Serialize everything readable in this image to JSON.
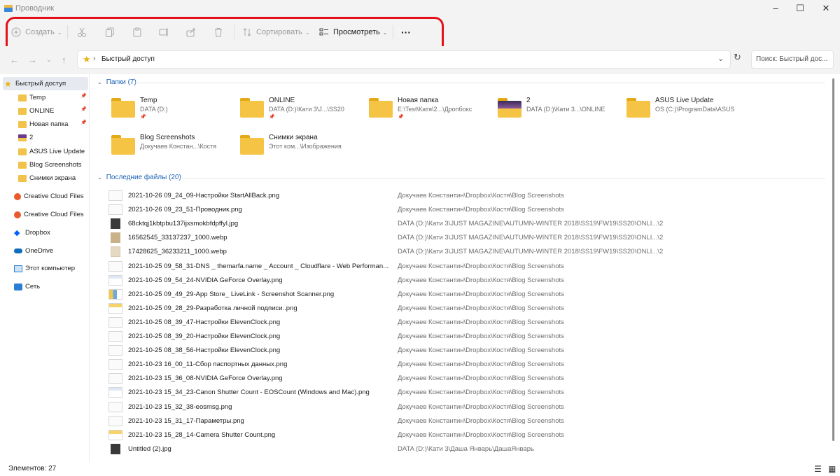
{
  "window": {
    "title": "Проводник"
  },
  "toolbar": {
    "create_label": "Создать",
    "sort_label": "Сортировать",
    "view_label": "Просмотреть",
    "more_label": "···"
  },
  "address": {
    "path": "Быстрый доступ",
    "search_placeholder": "Поиск: Быстрый дос..."
  },
  "sidebar": {
    "items": [
      {
        "label": "Быстрый доступ",
        "icon": "star-icon",
        "pinned": false,
        "selected": true
      },
      {
        "label": "Temp",
        "icon": "folder-icon",
        "pinned": true
      },
      {
        "label": "ONLINE",
        "icon": "folder-icon",
        "pinned": true
      },
      {
        "label": "Новая папка",
        "icon": "folder-icon",
        "pinned": true
      },
      {
        "label": "2",
        "icon": "folder-image-icon",
        "pinned": false
      },
      {
        "label": "ASUS Live Update",
        "icon": "folder-icon",
        "pinned": false
      },
      {
        "label": "Blog Screenshots",
        "icon": "folder-icon",
        "pinned": false
      },
      {
        "label": "Снимки экрана",
        "icon": "folder-icon",
        "pinned": false
      },
      {
        "label": "Creative Cloud Files",
        "icon": "creative-cloud-icon",
        "pinned": false
      },
      {
        "label": "Creative Cloud Files",
        "icon": "creative-cloud-icon",
        "pinned": false
      },
      {
        "label": "Dropbox",
        "icon": "dropbox-icon",
        "pinned": false
      },
      {
        "label": "OneDrive",
        "icon": "onedrive-icon",
        "pinned": false
      },
      {
        "label": "Этот компьютер",
        "icon": "computer-icon",
        "pinned": false
      },
      {
        "label": "Сеть",
        "icon": "network-icon",
        "pinned": false
      }
    ]
  },
  "folders_section": {
    "header": "Папки (7)",
    "items": [
      {
        "name": "Temp",
        "path": "DATA (D:)",
        "pinned": true
      },
      {
        "name": "ONLINE",
        "path": "DATA (D:)\\Кати 3\\J...\\SS20",
        "pinned": true
      },
      {
        "name": "Новая папка",
        "path": "E:\\Test\\Катя\\2...\\Дропбокс",
        "pinned": true
      },
      {
        "name": "2",
        "path": "DATA (D:)\\Кати 3...\\ONLINE",
        "pinned": false
      },
      {
        "name": "ASUS Live Update",
        "path": "OS (C:)\\ProgramData\\ASUS",
        "pinned": false
      },
      {
        "name": "Blog Screenshots",
        "path": "Докучаев Констан...\\Костя",
        "pinned": false
      },
      {
        "name": "Снимки экрана",
        "path": "Этот ком...\\Изображения",
        "pinned": false
      }
    ]
  },
  "recent_section": {
    "header": "Последние файлы (20)",
    "files": [
      {
        "name": "2021-10-26 09_24_09-Настройки StartAllBack.png",
        "location": "Докучаев Константин\\Dropbox\\Костя\\Blog Screenshots",
        "thumb": "doc"
      },
      {
        "name": "2021-10-26 09_23_51-Проводник.png",
        "location": "Докучаев Константин\\Dropbox\\Костя\\Blog Screenshots",
        "thumb": "doc"
      },
      {
        "name": "68cktqj1kbtpbu137ijxsmokbfdpffyl.jpg",
        "location": "DATA (D:)\\Кати 3\\JUST MAGAZINE\\AUTUMN-WINTER 2018\\SS19\\FW19\\SS20\\ONLI...\\2",
        "thumb": "photo-dark"
      },
      {
        "name": "16562545_33137237_1000.webp",
        "location": "DATA (D:)\\Кати 3\\JUST MAGAZINE\\AUTUMN-WINTER 2018\\SS19\\FW19\\SS20\\ONLI...\\2",
        "thumb": "photo-beige"
      },
      {
        "name": "17428625_36233211_1000.webp",
        "location": "DATA (D:)\\Кати 3\\JUST MAGAZINE\\AUTUMN-WINTER 2018\\SS19\\FW19\\SS20\\ONLI...\\2",
        "thumb": "photo-light"
      },
      {
        "name": "2021-10-25 09_58_31-DNS _ themarfa.name _ Account _ Cloudflare - Web Performan...",
        "location": "Докучаев Константин\\Dropbox\\Костя\\Blog Screenshots",
        "thumb": "doc"
      },
      {
        "name": "2021-10-25 09_54_24-NVIDIA GeForce Overlay.png",
        "location": "Докучаев Константин\\Dropbox\\Костя\\Blog Screenshots",
        "thumb": "doc-blue"
      },
      {
        "name": "2021-10-25 09_49_29-App Store_ LiveLink - Screenshot Scanner.png",
        "location": "Докучаев Константин\\Dropbox\\Костя\\Blog Screenshots",
        "thumb": "doc-color"
      },
      {
        "name": "2021-10-25 09_28_29-Разработка личной подписи..png",
        "location": "Докучаев Константин\\Dropbox\\Костя\\Blog Screenshots",
        "thumb": "doc-yellow"
      },
      {
        "name": "2021-10-25 08_39_47-Настройки ElevenClock.png",
        "location": "Докучаев Константин\\Dropbox\\Костя\\Blog Screenshots",
        "thumb": "doc"
      },
      {
        "name": "2021-10-25 08_39_20-Настройки ElevenClock.png",
        "location": "Докучаев Константин\\Dropbox\\Костя\\Blog Screenshots",
        "thumb": "doc"
      },
      {
        "name": "2021-10-25 08_38_56-Настройки ElevenClock.png",
        "location": "Докучаев Константин\\Dropbox\\Костя\\Blog Screenshots",
        "thumb": "doc"
      },
      {
        "name": "2021-10-23 16_00_11-Сбор паспортных данных.png",
        "location": "Докучаев Константин\\Dropbox\\Костя\\Blog Screenshots",
        "thumb": "doc"
      },
      {
        "name": "2021-10-23 15_36_08-NVIDIA GeForce Overlay.png",
        "location": "Докучаев Константин\\Dropbox\\Костя\\Blog Screenshots",
        "thumb": "doc"
      },
      {
        "name": "2021-10-23 15_34_23-Canon Shutter Count - EOSCount (Windows and Mac).png",
        "location": "Докучаев Константин\\Dropbox\\Костя\\Blog Screenshots",
        "thumb": "doc-blue"
      },
      {
        "name": "2021-10-23 15_32_38-eosmsg.png",
        "location": "Докучаев Константин\\Dropbox\\Костя\\Blog Screenshots",
        "thumb": "doc"
      },
      {
        "name": "2021-10-23 15_31_17-Параметры.png",
        "location": "Докучаев Константин\\Dropbox\\Костя\\Blog Screenshots",
        "thumb": "doc"
      },
      {
        "name": "2021-10-23 15_28_14-Camera Shutter Count.png",
        "location": "Докучаев Константин\\Dropbox\\Костя\\Blog Screenshots",
        "thumb": "doc-yellow"
      },
      {
        "name": "Untitled (2).jpg",
        "location": "DATA (D:)\\Кати 3\\Даша Январь\\ДашаЯнварь",
        "thumb": "photo-dark"
      }
    ]
  },
  "status": {
    "items_count": "Элементов: 27"
  },
  "colors": {
    "accent": "#1a5fb4",
    "folder": "#f6c445",
    "highlight": "#e3111b",
    "chrome": "#f3f3f3"
  }
}
